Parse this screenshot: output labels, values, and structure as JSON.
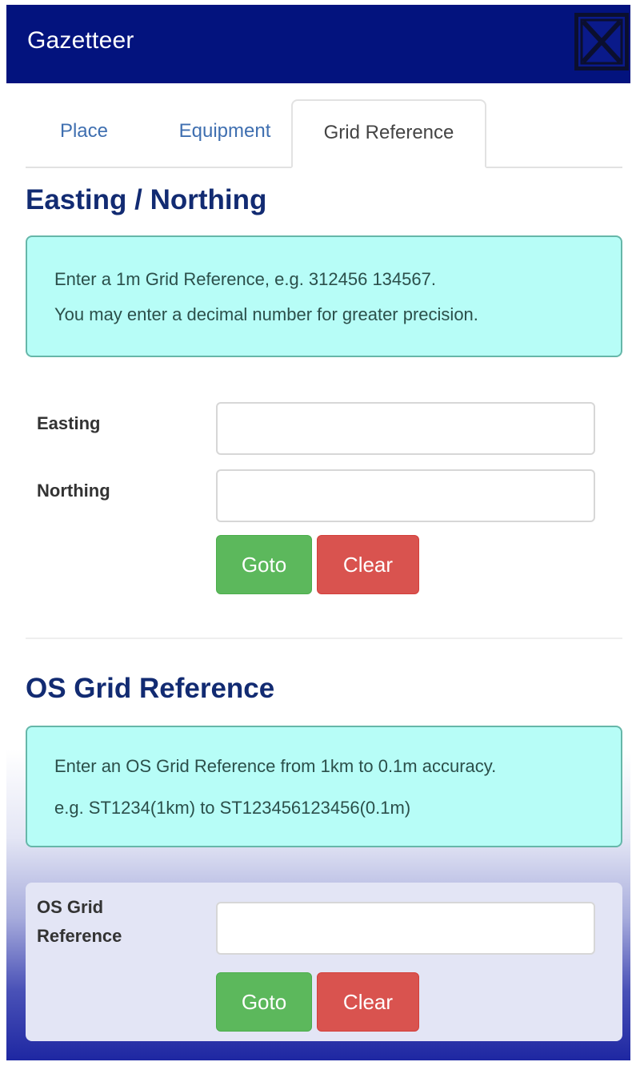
{
  "header": {
    "title": "Gazetteer",
    "close_icon": "close-x-icon"
  },
  "tabs": [
    {
      "label": "Place",
      "active": false
    },
    {
      "label": "Equipment",
      "active": false
    },
    {
      "label": "Grid Reference",
      "active": true
    }
  ],
  "easting_northing": {
    "title": "Easting / Northing",
    "info_lines": [
      "Enter a 1m Grid Reference, e.g. 312456 134567.",
      "You may enter a decimal number for greater precision."
    ],
    "easting_label": "Easting",
    "easting_value": "",
    "northing_label": "Northing",
    "northing_value": "",
    "goto_label": "Goto",
    "clear_label": "Clear"
  },
  "os_grid": {
    "title": "OS Grid Reference",
    "info_lines": [
      "Enter an OS Grid Reference from 1km to 0.1m accuracy.",
      "e.g. ST1234(1km) to ST123456123456(0.1m)"
    ],
    "label_line1": "OS Grid",
    "label_line2": "Reference",
    "value": "",
    "goto_label": "Goto",
    "clear_label": "Clear"
  },
  "colors": {
    "header_bg": "#03137e",
    "info_bg": "#b7fdf7",
    "goto": "#5cb85c",
    "clear": "#d9534f",
    "section_title": "#122b72",
    "tab_link": "#3f6fb0"
  }
}
